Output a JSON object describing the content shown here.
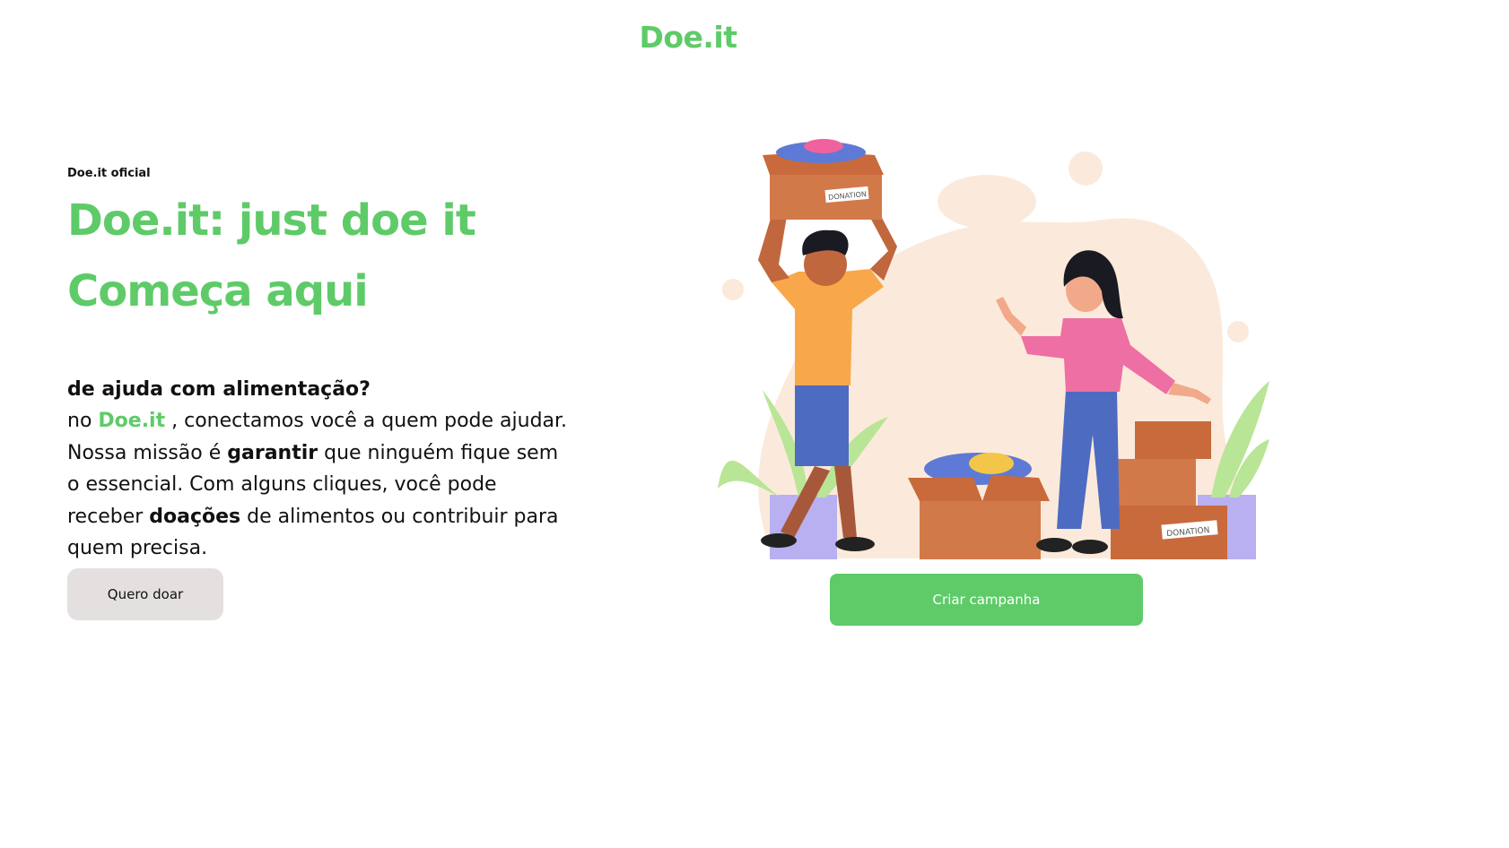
{
  "header": {
    "logo": "Doe.it"
  },
  "hero": {
    "eyebrow": "Doe.it oficial",
    "headline_line1": "Doe.it: just doe it",
    "headline_line2": "Começa aqui",
    "question": "de ajuda com alimentação?",
    "body": {
      "p1": "no ",
      "brand": "Doe.it",
      "p2": " , conectamos você a quem pode ajudar. Nossa missão é ",
      "bold1": "garantir",
      "p3": " que ninguém fique sem o essencial. Com alguns cliques, você pode receber ",
      "bold2": "doações",
      "p4": " de alimentos ou contribuir para quem precisa."
    },
    "donate_button": "Quero doar",
    "campaign_button": "Criar campanha"
  },
  "illustration": {
    "box_label_1": "DONATION",
    "box_label_2": "DONATION"
  },
  "colors": {
    "brand_green": "#5ecb68",
    "donate_button_bg": "#e5e0e0",
    "blob_bg": "#fbeadb",
    "box_brown": "#d2794a"
  }
}
